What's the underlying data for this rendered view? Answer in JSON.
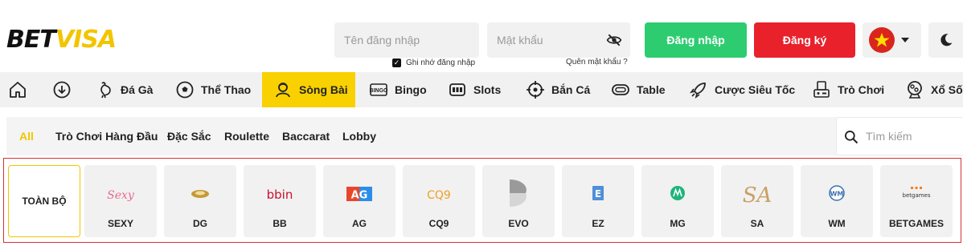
{
  "logo": {
    "part1": "BET",
    "part2": "VISA"
  },
  "login": {
    "username_placeholder": "Tên đăng nhập",
    "password_placeholder": "Mật khẩu",
    "remember": "Ghi nhớ đăng nhập",
    "forgot": "Quên mật khẩu ?",
    "login_label": "Đăng nhập",
    "register_label": "Đăng ký"
  },
  "nav": {
    "items": [
      {
        "label": "",
        "icon": "home-icon"
      },
      {
        "label": "",
        "icon": "download-icon"
      },
      {
        "label": "Đá Gà",
        "icon": "rooster-icon"
      },
      {
        "label": "Thể Thao",
        "icon": "football-icon"
      },
      {
        "label": "Sòng Bài",
        "icon": "dealer-icon",
        "active": true
      },
      {
        "label": "Bingo",
        "icon": "bingo-icon"
      },
      {
        "label": "Slots",
        "icon": "slot-machine-icon"
      },
      {
        "label": "Bắn Cá",
        "icon": "target-icon"
      },
      {
        "label": "Table",
        "icon": "table-icon"
      },
      {
        "label": "Cược Siêu Tốc",
        "icon": "rocket-icon"
      },
      {
        "label": "Trò Chơi",
        "icon": "arcade-icon"
      },
      {
        "label": "Xổ Số",
        "icon": "lottery-icon"
      }
    ]
  },
  "filters": {
    "items": [
      "All",
      "Trò Chơi Hàng Đầu",
      "Đặc Sắc",
      "Roulette",
      "Baccarat",
      "Lobby"
    ],
    "search_placeholder": "Tìm kiếm"
  },
  "providers": {
    "all_label": "TOÀN BỘ",
    "items": [
      {
        "name": "SEXY",
        "logo_text": "Sexy"
      },
      {
        "name": "DG",
        "logo_text": ""
      },
      {
        "name": "BB",
        "logo_text": "bbin"
      },
      {
        "name": "AG",
        "logo_text": "AG"
      },
      {
        "name": "CQ9",
        "logo_text": "CQ9"
      },
      {
        "name": "EVO",
        "logo_text": ""
      },
      {
        "name": "EZ",
        "logo_text": "E"
      },
      {
        "name": "MG",
        "logo_text": ""
      },
      {
        "name": "SA",
        "logo_text": "SA"
      },
      {
        "name": "WM",
        "logo_text": "WM"
      },
      {
        "name": "BETGAMES",
        "logo_text": "betgames"
      }
    ]
  },
  "colors": {
    "accent": "#f9d100",
    "login": "#2ecc71",
    "register": "#e8212b",
    "outline": "#d43434"
  }
}
